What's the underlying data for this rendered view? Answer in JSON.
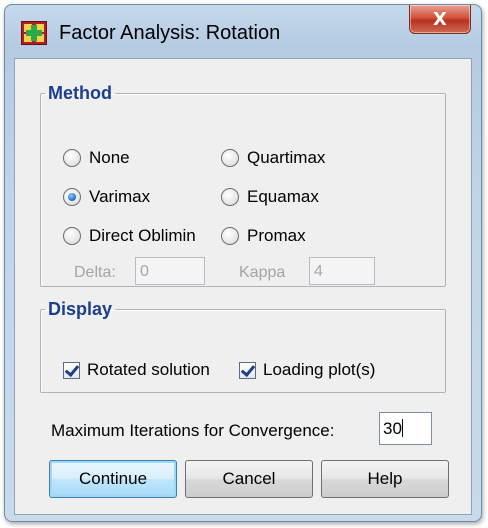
{
  "window": {
    "title": "Factor Analysis: Rotation",
    "close_label": "X"
  },
  "method": {
    "legend": "Method",
    "options": [
      {
        "label": "None",
        "checked": false
      },
      {
        "label": "Varimax",
        "checked": true
      },
      {
        "label": "Direct Oblimin",
        "checked": false
      },
      {
        "label": "Quartimax",
        "checked": false
      },
      {
        "label": "Equamax",
        "checked": false
      },
      {
        "label": "Promax",
        "checked": false
      }
    ],
    "delta_label": "Delta:",
    "delta_value": "0",
    "kappa_label": "Kappa",
    "kappa_value": "4"
  },
  "display": {
    "legend": "Display",
    "rotated_solution": {
      "label": "Rotated solution",
      "checked": true
    },
    "loading_plots": {
      "label": "Loading plot(s)",
      "checked": true
    }
  },
  "iterations": {
    "label": "Maximum Iterations for Convergence:",
    "value": "30"
  },
  "buttons": {
    "continue": "Continue",
    "cancel": "Cancel",
    "help": "Help"
  }
}
